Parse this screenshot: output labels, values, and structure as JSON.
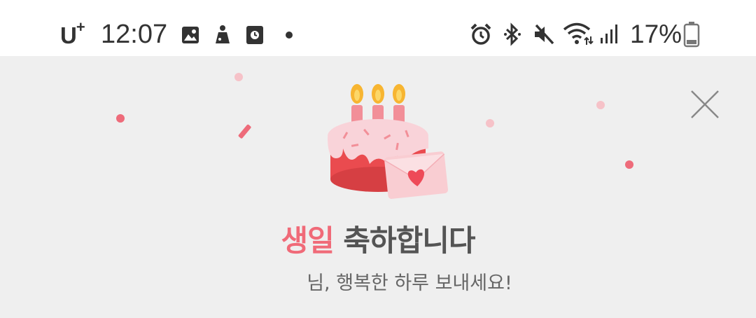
{
  "status_bar": {
    "carrier": "U",
    "carrier_plus": "+",
    "time": "12:07",
    "battery": "17%",
    "icons": [
      "gallery-icon",
      "game-icon",
      "clock-app-icon",
      "dot-icon",
      "alarm-icon",
      "bluetooth-icon",
      "mute-icon",
      "wifi-icon",
      "signal-icon",
      "battery-icon"
    ]
  },
  "banner": {
    "title_accent": "생일",
    "title_rest": " 축하합니다",
    "subtitle": "님, 행복한 하루 보내세요!",
    "accent_color": "#f06a78",
    "background_color": "#efefef"
  }
}
